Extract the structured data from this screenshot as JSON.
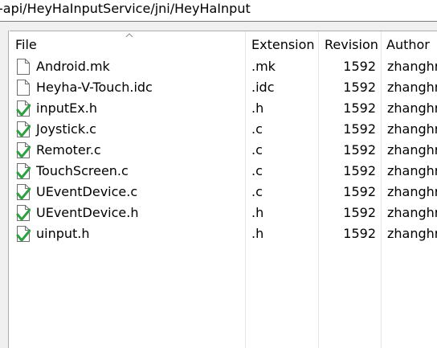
{
  "path_bar": {
    "text": "-api/HeyHaInputService/jni/HeyHaInput"
  },
  "table": {
    "columns": [
      "File",
      "Extension",
      "Revision",
      "Author"
    ],
    "sorted_column": "File",
    "rows": [
      {
        "name": "Android.mk",
        "extension": ".mk",
        "revision": "1592",
        "author": "zhanghr",
        "icon": "plain-file-icon"
      },
      {
        "name": "Heyha-V-Touch.idc",
        "extension": ".idc",
        "revision": "1592",
        "author": "zhanghr",
        "icon": "plain-file-icon"
      },
      {
        "name": "inputEx.h",
        "extension": ".h",
        "revision": "1592",
        "author": "zhanghr",
        "icon": "versioned-file-icon"
      },
      {
        "name": "Joystick.c",
        "extension": ".c",
        "revision": "1592",
        "author": "zhanghr",
        "icon": "versioned-file-icon"
      },
      {
        "name": "Remoter.c",
        "extension": ".c",
        "revision": "1592",
        "author": "zhanghr",
        "icon": "versioned-file-icon"
      },
      {
        "name": "TouchScreen.c",
        "extension": ".c",
        "revision": "1592",
        "author": "zhanghr",
        "icon": "versioned-file-icon"
      },
      {
        "name": "UEventDevice.c",
        "extension": ".c",
        "revision": "1592",
        "author": "zhanghr",
        "icon": "versioned-file-icon"
      },
      {
        "name": "UEventDevice.h",
        "extension": ".h",
        "revision": "1592",
        "author": "zhanghr",
        "icon": "versioned-file-icon"
      },
      {
        "name": "uinput.h",
        "extension": ".h",
        "revision": "1592",
        "author": "zhanghr",
        "icon": "versioned-file-icon"
      }
    ]
  },
  "colors": {
    "background": "#ffffff",
    "chrome": "#f0f0f0",
    "border": "#adadad",
    "separator": "#e5e5e5",
    "checkmark": "#2ea043"
  }
}
